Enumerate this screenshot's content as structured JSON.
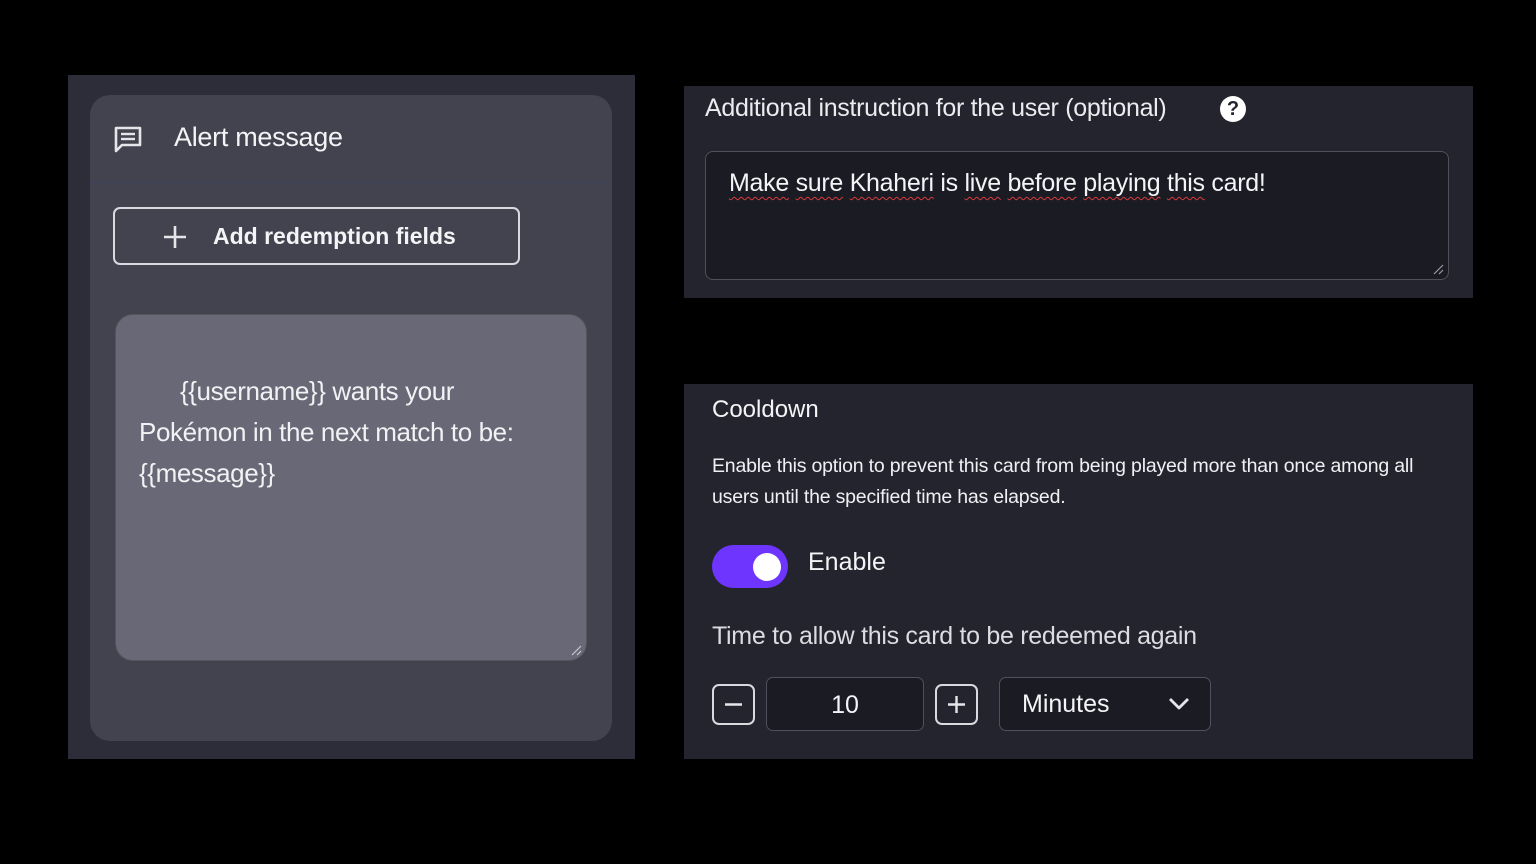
{
  "alert": {
    "title": "Alert message",
    "add_fields_label": "Add redemption fields",
    "message_text": "{{username}} wants your\nPokémon in the next match to be:\n{{message}}"
  },
  "instruction": {
    "label": "Additional instruction for the user (optional)",
    "help_glyph": "?",
    "value_words": [
      "Make",
      "sure",
      "Khaheri",
      "is",
      "live",
      "before",
      "playing",
      "this",
      "card!"
    ]
  },
  "cooldown": {
    "title": "Cooldown",
    "description": "Enable this option to prevent this card from being played more than once among all users until the specified time has elapsed.",
    "enabled": true,
    "enable_label": "Enable",
    "time_label": "Time to allow this card to be redeemed again",
    "amount": "10",
    "unit": "Minutes"
  },
  "colors": {
    "toggle_on": "#6e35ff",
    "background": "#000000",
    "panel": "#24242e"
  },
  "icons": [
    "message-icon",
    "plus-icon",
    "help-icon",
    "minus-icon",
    "chevron-down-icon"
  ]
}
